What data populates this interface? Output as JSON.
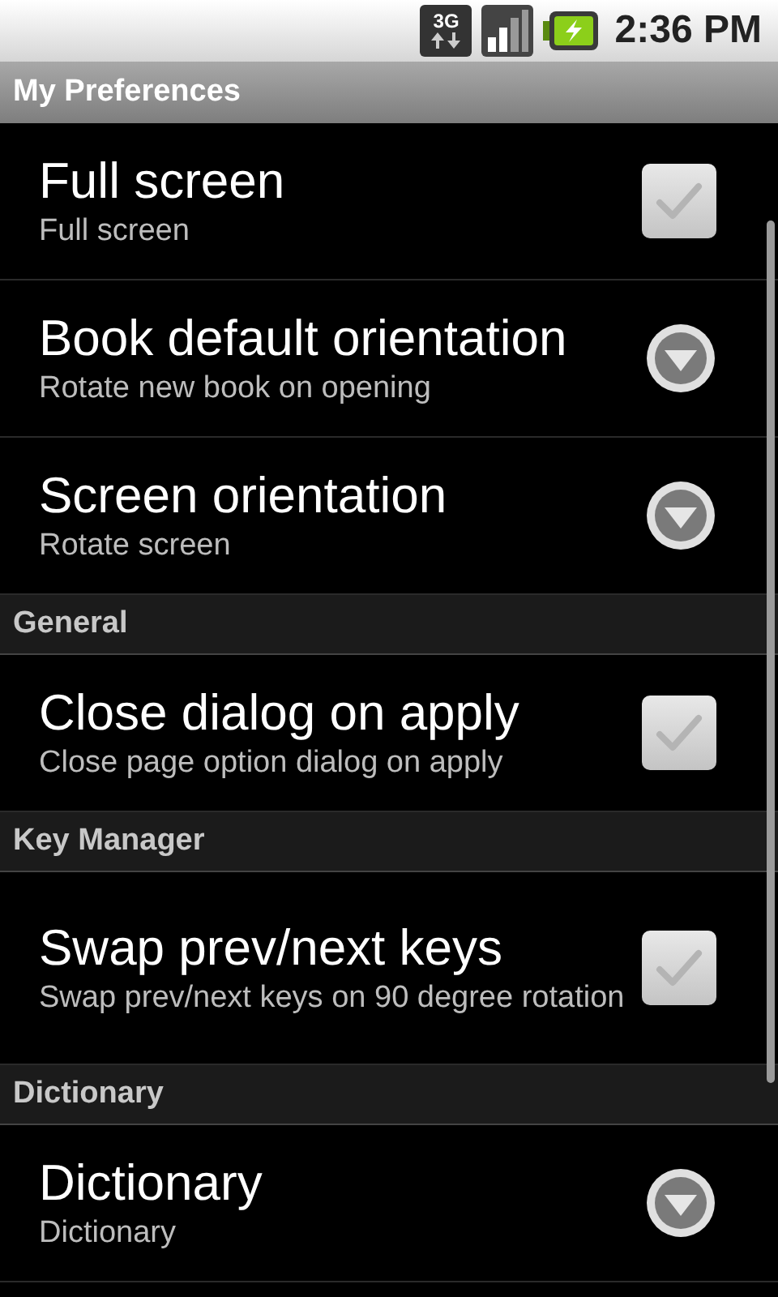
{
  "status_bar": {
    "network": "3G",
    "time": "2:36 PM"
  },
  "title": "My Preferences",
  "sections": [
    {
      "items": [
        {
          "kind": "checkbox",
          "title": "Full screen",
          "summary": "Full screen",
          "checked": false
        },
        {
          "kind": "list",
          "title": "Book default orientation",
          "summary": "Rotate new book on opening"
        },
        {
          "kind": "list",
          "title": "Screen orientation",
          "summary": "Rotate screen"
        }
      ]
    },
    {
      "header": "General",
      "items": [
        {
          "kind": "checkbox",
          "title": "Close dialog on apply",
          "summary": "Close page option dialog on apply",
          "checked": false
        }
      ]
    },
    {
      "header": "Key Manager",
      "items": [
        {
          "kind": "checkbox",
          "title": "Swap prev/next keys",
          "summary": "Swap prev/next keys on 90 degree rotation",
          "checked": false
        }
      ]
    },
    {
      "header": "Dictionary",
      "items": [
        {
          "kind": "list",
          "title": "Dictionary",
          "summary": "Dictionary"
        }
      ]
    }
  ]
}
